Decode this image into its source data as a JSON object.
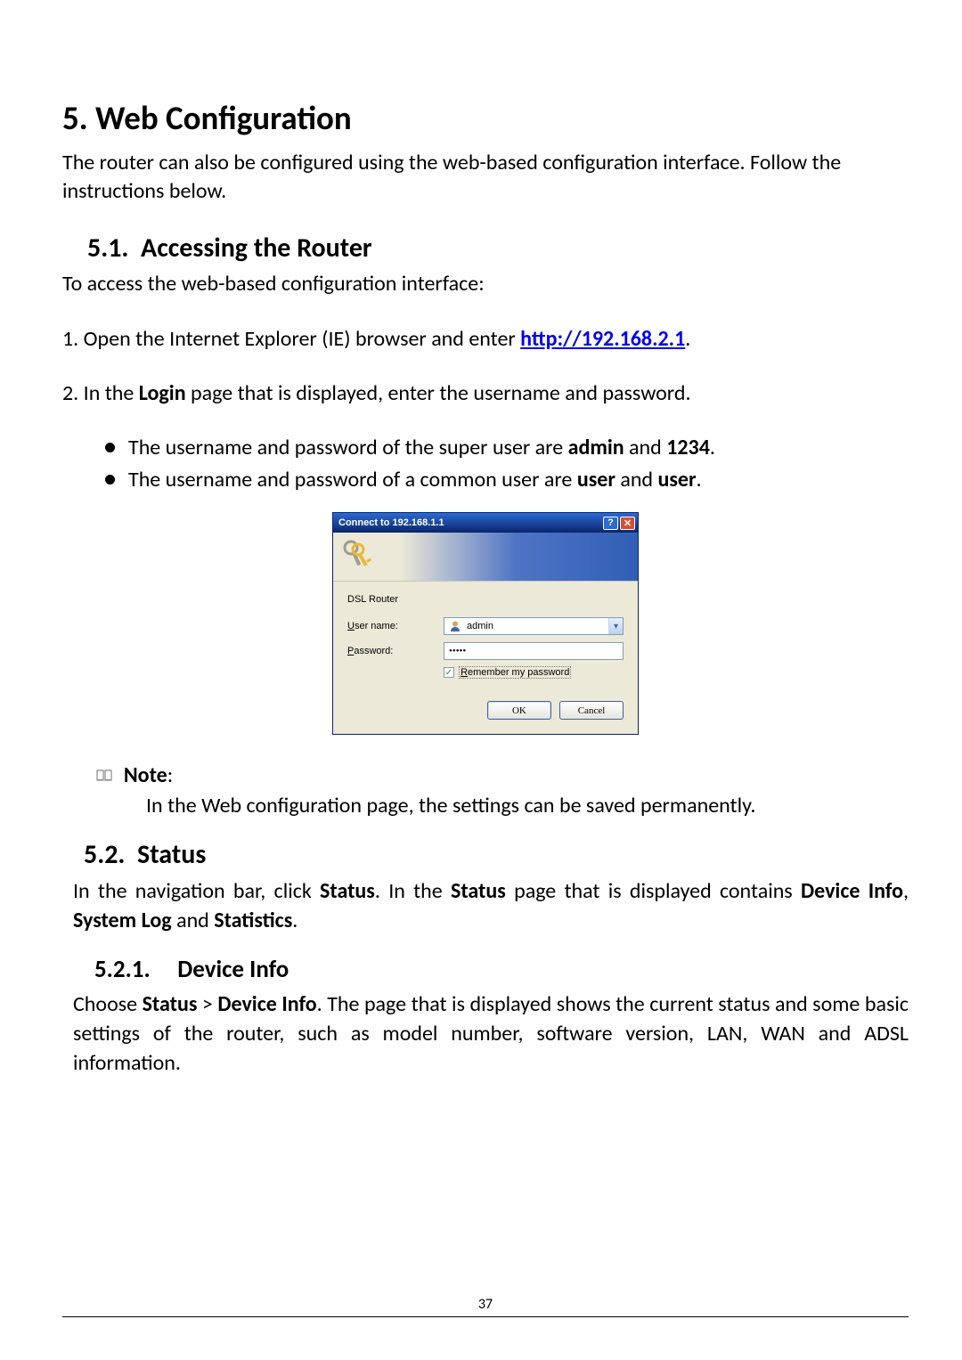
{
  "h1": "5. Web Configuration",
  "intro": "The router can also be configured using the web-based configuration interface. Follow the instructions below.",
  "h2_1_num": "5.1.",
  "h2_1_title": "Accessing the Router",
  "access_intro": "To access the web-based configuration interface:",
  "step1_prefix": "1. Open the Internet Explorer (IE) browser and enter ",
  "step1_link": "http://192.168.2.1",
  "step1_suffix": ".",
  "step2_a": "2. In the ",
  "step2_b": "Login",
  "step2_c": " page that is displayed, enter the username and password.",
  "bullets": [
    {
      "a": "The username and password of the super user are ",
      "b": "admin",
      "c": " and ",
      "d": "1234",
      "e": "."
    },
    {
      "a": "The username and password of a common user are ",
      "b": "user",
      "c": " and ",
      "d": "user",
      "e": "."
    }
  ],
  "dialog": {
    "title": "Connect to 192.168.1.1",
    "realm": "DSL Router",
    "username_label": "User name:",
    "username_hotkey": "U",
    "username_value": "admin",
    "password_label": "Password:",
    "password_hotkey": "P",
    "password_mask": "•••••",
    "remember_hotkey": "R",
    "remember_label": "emember my password",
    "ok": "OK",
    "cancel": "Cancel"
  },
  "note_label": "Note",
  "note_colon": ":",
  "note_text": "In the Web configuration page, the settings can be saved permanently.",
  "h2_2_num": "5.2.",
  "h2_2_title": "Status",
  "status_p_a": "In the navigation bar, click ",
  "status_p_b": "Status",
  "status_p_c": ". In the ",
  "status_p_d": "Status",
  "status_p_e": " page that is displayed contains ",
  "status_p_f": "Device Info",
  "status_p_g": ", ",
  "status_p_h": "System Log",
  "status_p_i": " and ",
  "status_p_j": "Statistics",
  "status_p_k": ".",
  "h3_num": "5.2.1.",
  "h3_title": "Device Info",
  "devinfo_a": "Choose ",
  "devinfo_b": "Status",
  "devinfo_c": " > ",
  "devinfo_d": "Device Info",
  "devinfo_e": ". The page that is displayed shows the current status and some basic settings of the router, such as model number, software version, LAN, WAN and ADSL information.",
  "page_number": "37"
}
